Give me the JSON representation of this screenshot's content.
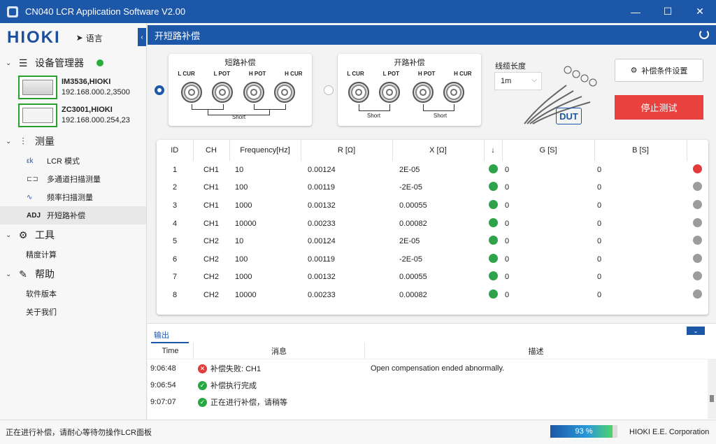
{
  "window": {
    "title": "CN040 LCR Application Software V2.00",
    "minimize": "—",
    "maximize": "☐",
    "close": "✕"
  },
  "sidebar": {
    "logo": "HIOKI",
    "language": "语言",
    "device_manager": "设备管理器",
    "devices": [
      {
        "name": "IM3536,HIOKI",
        "addr": "192.168.000.2,3500"
      },
      {
        "name": "ZC3001,HIOKI",
        "addr": "192.168.000.254,23"
      }
    ],
    "measure": "测量",
    "measure_items": [
      "LCR 模式",
      "多通道扫描测量",
      "频率扫描测量",
      "开短路补偿"
    ],
    "adj_label": "ADJ",
    "tools": "工具",
    "tools_items": [
      "精度计算"
    ],
    "help": "帮助",
    "help_items": [
      "软件版本",
      "关于我们"
    ]
  },
  "header": {
    "title": "开短路补偿"
  },
  "short_panel": {
    "title": "短路补偿",
    "ports": [
      "L CUR",
      "L POT",
      "H POT",
      "H CUR"
    ],
    "short_label": "Short"
  },
  "open_panel": {
    "title": "开路补偿",
    "ports": [
      "L CUR",
      "L POT",
      "H POT",
      "H CUR"
    ],
    "short_label": "Short"
  },
  "cable": {
    "label": "线缆长度",
    "value": "1m"
  },
  "dut_label": "DUT",
  "buttons": {
    "settings": "补偿条件设置",
    "stop": "停止测试"
  },
  "table": {
    "headers": [
      "ID",
      "CH",
      "Frequency[Hz]",
      "R [Ω]",
      "X [Ω]",
      "↓",
      "G [S]",
      "B [S]",
      ""
    ],
    "rows": [
      {
        "id": "1",
        "ch": "CH1",
        "freq": "10",
        "r": "0.00124",
        "x": "2E-05",
        "g": "0",
        "b": "0",
        "status": "red"
      },
      {
        "id": "2",
        "ch": "CH1",
        "freq": "100",
        "r": "0.00119",
        "x": "-2E-05",
        "g": "0",
        "b": "0",
        "status": "grey"
      },
      {
        "id": "3",
        "ch": "CH1",
        "freq": "1000",
        "r": "0.00132",
        "x": "0.00055",
        "g": "0",
        "b": "0",
        "status": "grey"
      },
      {
        "id": "4",
        "ch": "CH1",
        "freq": "10000",
        "r": "0.00233",
        "x": "0.00082",
        "g": "0",
        "b": "0",
        "status": "grey"
      },
      {
        "id": "5",
        "ch": "CH2",
        "freq": "10",
        "r": "0.00124",
        "x": "2E-05",
        "g": "0",
        "b": "0",
        "status": "grey"
      },
      {
        "id": "6",
        "ch": "CH2",
        "freq": "100",
        "r": "0.00119",
        "x": "-2E-05",
        "g": "0",
        "b": "0",
        "status": "grey"
      },
      {
        "id": "7",
        "ch": "CH2",
        "freq": "1000",
        "r": "0.00132",
        "x": "0.00055",
        "g": "0",
        "b": "0",
        "status": "grey"
      },
      {
        "id": "8",
        "ch": "CH2",
        "freq": "10000",
        "r": "0.00233",
        "x": "0.00082",
        "g": "0",
        "b": "0",
        "status": "grey"
      }
    ]
  },
  "output": {
    "tab": "输出",
    "headers": [
      "Time",
      "消息",
      "描述"
    ],
    "rows": [
      {
        "time": "9:06:48",
        "type": "error",
        "msg": "补偿失败: CH1",
        "desc": "Open compensation ended abnormally."
      },
      {
        "time": "9:06:54",
        "type": "ok",
        "msg": "补偿执行完成",
        "desc": ""
      },
      {
        "time": "9:07:07",
        "type": "ok",
        "msg": "正在进行补偿，请稍等",
        "desc": ""
      }
    ]
  },
  "status": {
    "message": "正在进行补偿，请耐心等待勿操作LCR面板",
    "progress": 93,
    "progress_text": "93 %",
    "company": "HIOKI E.E. Corporation"
  },
  "colors": {
    "primary": "#1d57a8",
    "stop": "#e8413e",
    "ok": "#2ea34a",
    "err": "#e23b3b"
  }
}
